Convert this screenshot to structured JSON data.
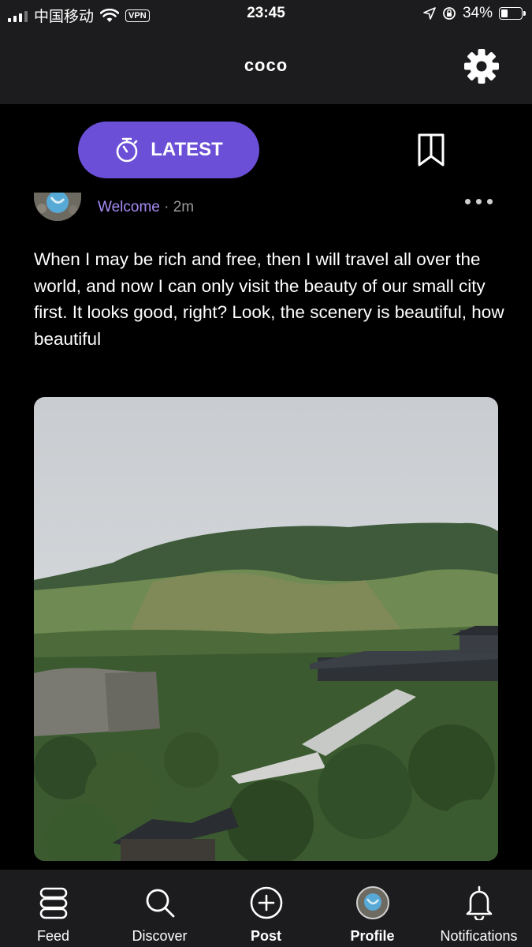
{
  "status_bar": {
    "carrier": "中国移动",
    "vpn": "VPN",
    "time": "23:45",
    "battery": "34%",
    "battery_level": 0.34
  },
  "header": {
    "title": "coco"
  },
  "tabs": {
    "latest_label": "LATEST"
  },
  "post": {
    "author": "Welcome",
    "separator": " · ",
    "time": "2m",
    "body": "When I may be rich and free, then I will travel all over the world, and now I can only visit the beauty of our small city first. It looks good, right? Look, the scenery is beautiful, how beautiful"
  },
  "nav": {
    "feed": "Feed",
    "discover": "Discover",
    "post": "Post",
    "profile": "Profile",
    "notifications": "Notifications"
  },
  "colors": {
    "accent": "#6b4fd6",
    "author": "#a58cf5",
    "bar_bg": "#1c1c1e",
    "background": "#000000"
  }
}
